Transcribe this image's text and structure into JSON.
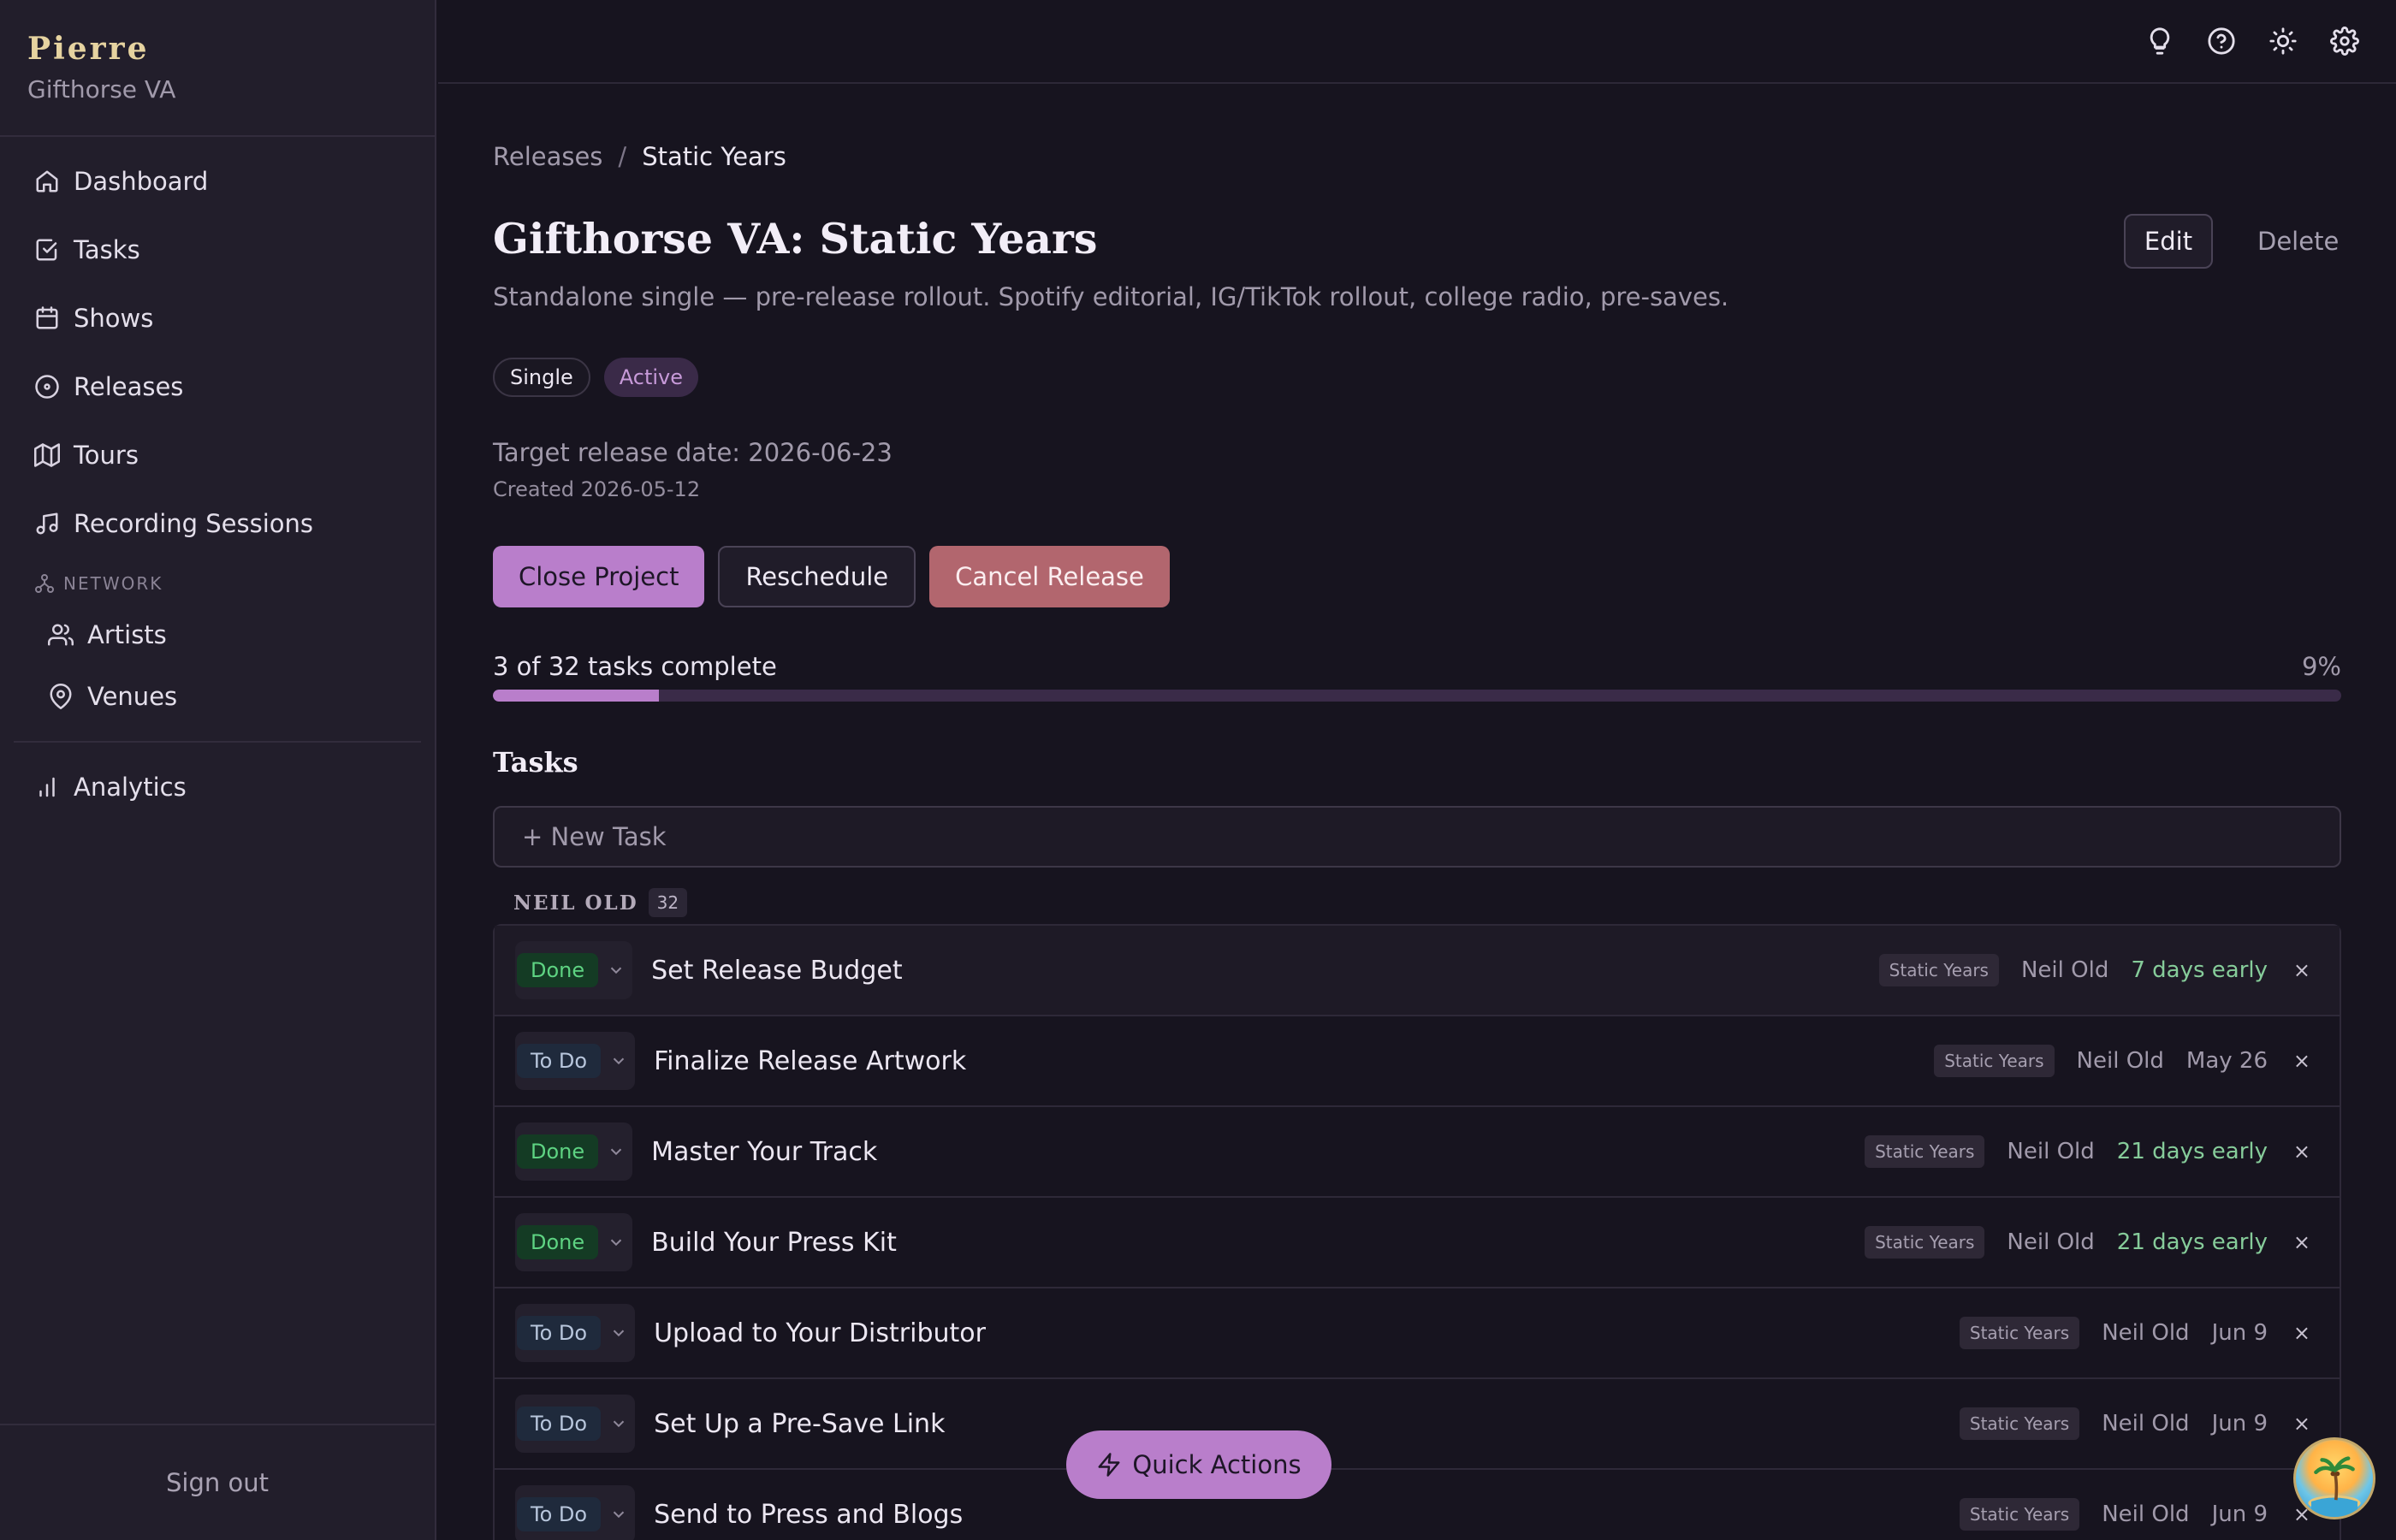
{
  "brand": {
    "name": "Pierre",
    "org": "Gifthorse VA"
  },
  "nav": {
    "items": [
      {
        "label": "Dashboard",
        "icon": "home-icon"
      },
      {
        "label": "Tasks",
        "icon": "check-square-icon"
      },
      {
        "label": "Shows",
        "icon": "calendar-icon"
      },
      {
        "label": "Releases",
        "icon": "disc-icon"
      },
      {
        "label": "Tours",
        "icon": "map-icon"
      },
      {
        "label": "Recording Sessions",
        "icon": "music-icon"
      }
    ],
    "section_label": "NETWORK",
    "network_items": [
      {
        "label": "Artists",
        "icon": "users-icon"
      },
      {
        "label": "Venues",
        "icon": "map-pin-icon"
      }
    ],
    "analytics": {
      "label": "Analytics",
      "icon": "bar-chart-icon"
    },
    "signout": "Sign out"
  },
  "topbar": {
    "icons": [
      "lightbulb-icon",
      "help-icon",
      "sun-icon",
      "settings-icon"
    ]
  },
  "breadcrumb": {
    "parent": "Releases",
    "separator": "/",
    "current": "Static Years"
  },
  "release": {
    "title": "Gifthorse VA: Static Years",
    "description": "Standalone single — pre-release rollout. Spotify editorial, IG/TikTok rollout, college radio, pre-saves.",
    "type_tag": "Single",
    "status_tag": "Active",
    "target_date": "Target release date: 2026-06-23",
    "created": "Created 2026-05-12"
  },
  "header_actions": {
    "edit": "Edit",
    "delete": "Delete"
  },
  "actions": {
    "close": "Close Project",
    "reschedule": "Reschedule",
    "cancel": "Cancel Release"
  },
  "progress": {
    "text": "3 of 32 tasks complete",
    "percent_label": "9%",
    "fraction": 0.09
  },
  "tasks": {
    "heading": "Tasks",
    "new_task": "+ New Task",
    "group": {
      "name": "NEIL OLD",
      "count": "32"
    },
    "rows": [
      {
        "status": "Done",
        "title": "Set Release Budget",
        "project": "Static Years",
        "assignee": "Neil Old",
        "due": "7 days early",
        "early": true
      },
      {
        "status": "To Do",
        "title": "Finalize Release Artwork",
        "project": "Static Years",
        "assignee": "Neil Old",
        "due": "May 26",
        "early": false
      },
      {
        "status": "Done",
        "title": "Master Your Track",
        "project": "Static Years",
        "assignee": "Neil Old",
        "due": "21 days early",
        "early": true
      },
      {
        "status": "Done",
        "title": "Build Your Press Kit",
        "project": "Static Years",
        "assignee": "Neil Old",
        "due": "21 days early",
        "early": true
      },
      {
        "status": "To Do",
        "title": "Upload to Your Distributor",
        "project": "Static Years",
        "assignee": "Neil Old",
        "due": "Jun 9",
        "early": false
      },
      {
        "status": "To Do",
        "title": "Set Up a Pre-Save Link",
        "project": "Static Years",
        "assignee": "Neil Old",
        "due": "Jun 9",
        "early": false
      },
      {
        "status": "To Do",
        "title": "Send to Press and Blogs",
        "project": "Static Years",
        "assignee": "Neil Old",
        "due": "Jun 9",
        "early": false
      }
    ],
    "remove_glyph": "×"
  },
  "quick_actions": {
    "label": "Quick Actions",
    "icon": "zap-icon"
  },
  "colors": {
    "accent": "#b97ecb",
    "danger": "#b2666e",
    "done": "#5ed382",
    "brand": "#e6d3a0"
  }
}
